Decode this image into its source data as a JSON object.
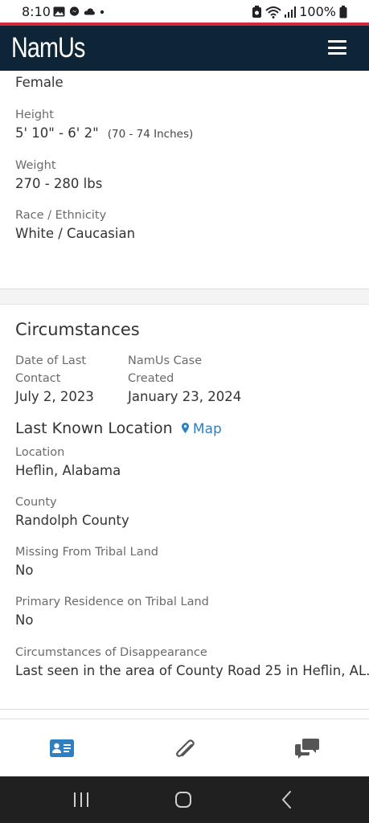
{
  "status_bar": {
    "time": "8:10",
    "battery": "100%"
  },
  "header": {
    "logo": "NamUs"
  },
  "profile": {
    "sex_value": "Female",
    "height_label": "Height",
    "height_value": "5' 10\" - 6' 2\"",
    "height_inches": "(70 - 74 Inches)",
    "weight_label": "Weight",
    "weight_value": "270 - 280 lbs",
    "race_label": "Race / Ethnicity",
    "race_value": "White / Caucasian"
  },
  "circumstances": {
    "title": "Circumstances",
    "date_last_contact_label_1": "Date of Last",
    "date_last_contact_label_2": "Contact",
    "date_last_contact_value": "July 2, 2023",
    "case_created_label_1": "NamUs Case",
    "case_created_label_2": "Created",
    "case_created_value": "January 23, 2024"
  },
  "last_known_location": {
    "title": "Last Known Location",
    "map_link": "Map",
    "location_label": "Location",
    "location_value": "Heflin, Alabama",
    "county_label": "County",
    "county_value": "Randolph County",
    "tribal_land_label": "Missing From Tribal Land",
    "tribal_land_value": "No",
    "residence_label": "Primary Residence on Tribal Land",
    "residence_value": "No",
    "disappearance_label": "Circumstances of Disappearance",
    "disappearance_value": "Last seen in the area of County Road 25 in Heflin, AL."
  },
  "tabs": [
    {
      "icon": "id-card-icon",
      "active": true
    },
    {
      "icon": "paperclip-icon",
      "active": false
    },
    {
      "icon": "chat-bubbles-icon",
      "active": false
    }
  ],
  "colors": {
    "header_bg": "#0e2537",
    "accent_red": "#d42b3c",
    "link_blue": "#2f7fc1",
    "tab_active": "#2f7fc1",
    "tab_inactive": "#555555"
  }
}
